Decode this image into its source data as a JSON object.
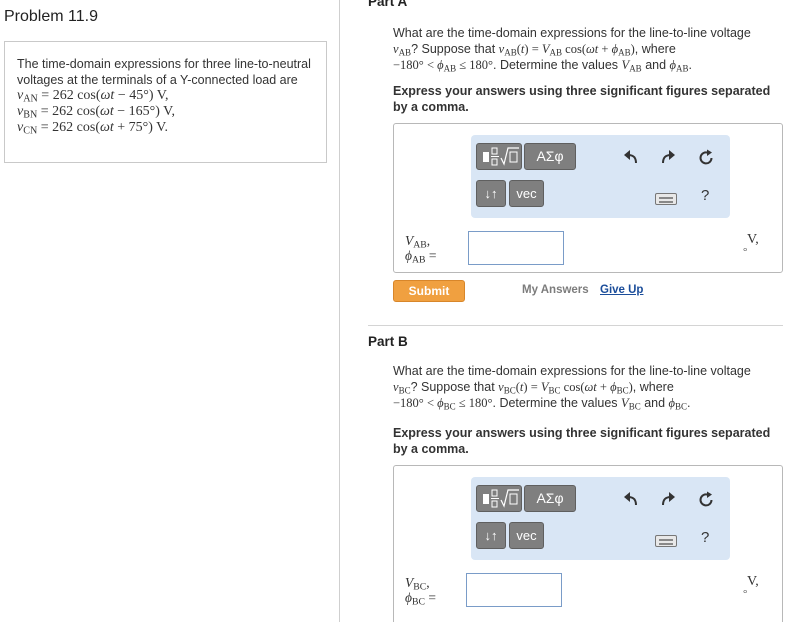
{
  "problem": {
    "title": "Problem 11.9",
    "statement": "The time-domain expressions for three line-to-neutral voltages at the terminals of a Y-connected load are",
    "equations": [
      {
        "var": "v",
        "sub": "AN",
        "amp": "262",
        "fn": "cos",
        "sign": "−",
        "angle": "45",
        "tail": " V,"
      },
      {
        "var": "v",
        "sub": "BN",
        "amp": "262",
        "fn": "cos",
        "sign": "−",
        "angle": "165",
        "tail": " V,"
      },
      {
        "var": "v",
        "sub": "CN",
        "amp": "262",
        "fn": "cos",
        "sign": "+",
        "angle": "75",
        "tail": " V."
      }
    ]
  },
  "part_a": {
    "title": "Part A",
    "q_text1": "What are the time-domain expressions for the line-to-line voltage",
    "q_var": "v",
    "q_sub": "AB",
    "q_text2": "? Suppose that",
    "q_text3": ", where",
    "q_range_low": "−180°",
    "q_range_high": "180°",
    "q_text4": ". Determine the values",
    "q_and": "and",
    "instruction": "Express your answers using three significant figures separated by a comma.",
    "label_v": "V",
    "label_phi": "ϕ",
    "label_sub": "AB",
    "units": "V,",
    "submit": "Submit",
    "my_answers": "My Answers",
    "give_up": "Give Up"
  },
  "part_b": {
    "title": "Part B",
    "q_text1": "What are the time-domain expressions for the line-to-line voltage",
    "q_var": "v",
    "q_sub": "BC",
    "q_text2": "? Suppose that",
    "q_text3": ", where",
    "q_range_low": "−180°",
    "q_range_high": "180°",
    "q_text4": ". Determine the values",
    "q_and": "and",
    "instruction": "Express your answers using three significant figures separated by a comma.",
    "label_v": "V",
    "label_phi": "ϕ",
    "label_sub": "BC",
    "units": "V,"
  },
  "toolbar": {
    "templates_icon": "fraction-root-template-icon",
    "greek_label": "ΑΣφ",
    "arrows_label": "↓↑",
    "vec_label": "vec",
    "undo_icon": "undo-icon",
    "redo_icon": "redo-icon",
    "reset_icon": "reset-icon",
    "keyboard_icon": "keyboard-icon",
    "help_label": "?"
  }
}
